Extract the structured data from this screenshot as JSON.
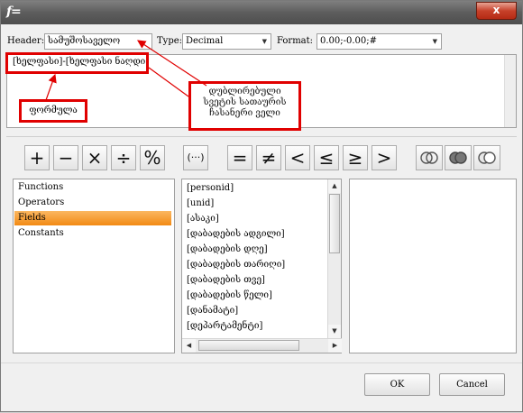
{
  "window": {
    "app_icon": "f=",
    "close_label": "x"
  },
  "header": {
    "header_label": "Header:",
    "header_value": "სამუშოსაველო",
    "type_label": "Type:",
    "type_value": "Decimal",
    "format_label": "Format:",
    "format_value": "0.00;-0.00;#"
  },
  "formula": {
    "text": "[ხელფასი]-[ხელფასი ნაღდი]"
  },
  "annotations": {
    "note_lines": [
      "დუბლირებული",
      "სვეტის სათაურის",
      "ჩასანერი ველი"
    ],
    "formula_label": "ფორმულა",
    "accent_color": "#e00000"
  },
  "operators": [
    {
      "name": "plus-button",
      "label": "+"
    },
    {
      "name": "minus-button",
      "label": "−"
    },
    {
      "name": "multiply-button",
      "label": "×"
    },
    {
      "name": "divide-button",
      "label": "÷"
    },
    {
      "name": "percent-button",
      "label": "%"
    },
    {
      "name": "parentheses-button",
      "label": "(···)"
    },
    {
      "name": "equals-button",
      "label": "="
    },
    {
      "name": "not-equals-button",
      "label": "≠"
    },
    {
      "name": "less-than-button",
      "label": "<"
    },
    {
      "name": "less-or-equal-button",
      "label": "≤"
    },
    {
      "name": "greater-or-equal-button",
      "label": "≥"
    },
    {
      "name": "greater-than-button",
      "label": ">"
    },
    {
      "name": "intersect-icon",
      "label": ""
    },
    {
      "name": "union-icon",
      "label": ""
    },
    {
      "name": "exclude-icon",
      "label": ""
    }
  ],
  "categories": [
    {
      "label": "Functions",
      "selected": false
    },
    {
      "label": "Operators",
      "selected": false
    },
    {
      "label": "Fields",
      "selected": true
    },
    {
      "label": "Constants",
      "selected": false
    }
  ],
  "fields": [
    "[personid]",
    "[unid]",
    "[ასაკი]",
    "[დაბადების ადგილი]",
    "[დაბადების დღე]",
    "[დაბადების თარიღი]",
    "[დაბადების თვე]",
    "[დაბადების წელი]",
    "[დანამატი]",
    "[დეპარტამენტი]"
  ],
  "buttons": {
    "ok": "OK",
    "cancel": "Cancel"
  }
}
